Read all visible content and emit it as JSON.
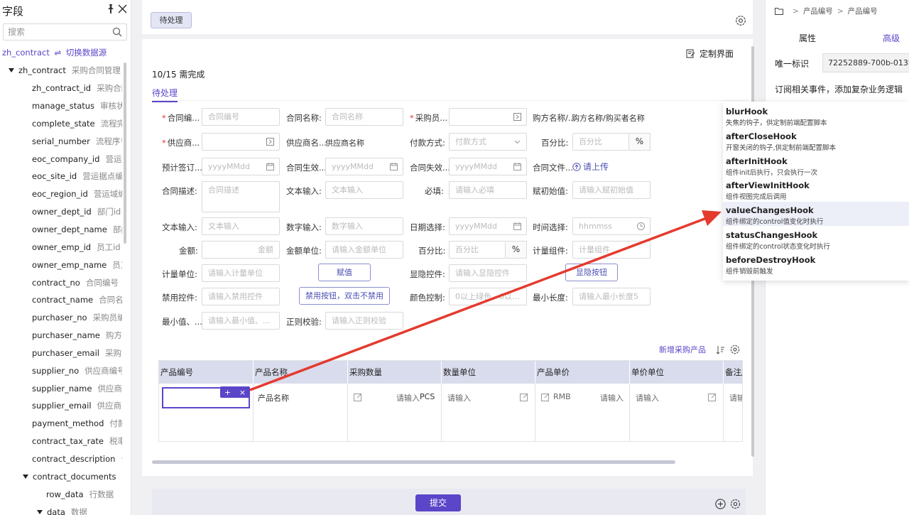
{
  "left_panel": {
    "title": "字段",
    "search_placeholder": "搜索",
    "source_name": "zh_contract",
    "source_switch_symbol": "⇌",
    "source_switch": "切换数据源",
    "tree": [
      {
        "name": "zh_contract",
        "desc": "采购合同管理",
        "level": 0,
        "expanded": true
      },
      {
        "name": "zh_contract_id",
        "desc": "采购合同",
        "level": 1
      },
      {
        "name": "manage_status",
        "desc": "审核状态",
        "level": 1
      },
      {
        "name": "complete_state",
        "desc": "流程完成",
        "level": 1
      },
      {
        "name": "serial_number",
        "desc": "流程序号",
        "level": 1
      },
      {
        "name": "eoc_company_id",
        "desc": "营运公",
        "level": 1
      },
      {
        "name": "eoc_site_id",
        "desc": "营运据点编号",
        "level": 1
      },
      {
        "name": "eoc_region_id",
        "desc": "营运域编号",
        "level": 1
      },
      {
        "name": "owner_dept_id",
        "desc": "部门id",
        "level": 1
      },
      {
        "name": "owner_dept_name",
        "desc": "部门",
        "level": 1
      },
      {
        "name": "owner_emp_id",
        "desc": "员工id",
        "level": 1
      },
      {
        "name": "owner_emp_name",
        "desc": "员工",
        "level": 1
      },
      {
        "name": "contract_no",
        "desc": "合同编号",
        "level": 1
      },
      {
        "name": "contract_name",
        "desc": "合同名称",
        "level": 1
      },
      {
        "name": "purchaser_no",
        "desc": "采购员编号",
        "level": 1
      },
      {
        "name": "purchaser_name",
        "desc": "购方名",
        "level": 1
      },
      {
        "name": "purchaser_email",
        "desc": "采购商",
        "level": 1
      },
      {
        "name": "supplier_no",
        "desc": "供应商编号",
        "level": 1
      },
      {
        "name": "supplier_name",
        "desc": "供应商名",
        "level": 1
      },
      {
        "name": "supplier_email",
        "desc": "供应商邮",
        "level": 1
      },
      {
        "name": "payment_method",
        "desc": "付款方",
        "level": 1
      },
      {
        "name": "contract_tax_rate",
        "desc": "税率",
        "level": 1
      },
      {
        "name": "contract_description",
        "desc": "合",
        "level": 1
      },
      {
        "name": "contract_documents",
        "desc": "合",
        "level": 1,
        "expanded": true
      },
      {
        "name": "row_data",
        "desc": "行数据",
        "level": 2
      },
      {
        "name": "data",
        "desc": "数据",
        "level": 2,
        "expanded": true
      }
    ]
  },
  "tabbar": {
    "pending_tab": "待处理"
  },
  "form": {
    "custom_link": "定制界面",
    "progress": "10/15 需完成",
    "section_tab": "待处理",
    "row1": {
      "f1_label": "合同编...",
      "f1_ph": "合同编号",
      "f2_label": "合同名称:",
      "f2_ph": "合同名称",
      "f3_label": "采购员...",
      "f4_label": "购方名称/...",
      "f4_value": "购方名称/购买者名称"
    },
    "row2": {
      "f1_label": "供应商...",
      "f2_label": "供应商名...",
      "f2_value": "供应商名称",
      "f3_label": "付款方式:",
      "f3_ph": "付款方式",
      "f4_label": "百分比:",
      "f4_ph": "百分比",
      "f4_unit": "%"
    },
    "row3": {
      "f1_label": "预计签订...",
      "f1_ph": "yyyyMMdd",
      "f2_label": "合同生效...",
      "f2_ph": "yyyyMMdd",
      "f3_label": "合同失效...",
      "f3_ph": "yyyyMMdd",
      "f4_label": "合同文件...",
      "f4_upload": "请上传"
    },
    "row4": {
      "f1_label": "合同描述:",
      "f1_ph": "合同描述",
      "f2_label": "文本输入:",
      "f2_ph": "文本输入",
      "f3_label": "必填:",
      "f3_ph": "请输入必填",
      "f4_label": "赋初始值:",
      "f4_ph": "请输入赋初始值"
    },
    "row5": {
      "f1_label": "文本输入:",
      "f1_ph": "文本输入",
      "f2_label": "数字输入:",
      "f2_ph": "数字输入",
      "f3_label": "日期选择:",
      "f3_ph": "yyyyMMdd",
      "f4_label": "时间选择:",
      "f4_ph": "hhmmss"
    },
    "row6": {
      "f1_label": "金额:",
      "f1_ph": "金额",
      "f2_label": "金额单位:",
      "f2_ph": "请输入金额单位",
      "f3_label": "百分比:",
      "f3_ph": "百分比",
      "f3_unit": "%",
      "f4_label": "计量组件:",
      "f4_ph": "计量组件"
    },
    "row7": {
      "f1_label": "计量单位:",
      "f1_ph": "请输入计量单位",
      "btn_assign": "赋值",
      "f3_label": "显隐控件:",
      "f3_ph": "请输入显隐控件",
      "btn_toggle": "显隐按钮"
    },
    "row8": {
      "f1_label": "禁用控件:",
      "f1_ph": "请输入禁用控件",
      "btn_disable": "禁用按钮，双击不禁用",
      "f3_label": "颜色控制:",
      "f3_ph": "0以上绿色，0以...",
      "f4_label": "最小长度:",
      "f4_ph": "请输入最小长度5"
    },
    "row9": {
      "f1_label": "最小值、...",
      "f1_ph": "请输入最小值、...",
      "f2_label": "正则校验:",
      "f2_ph": "请输入正则校验"
    }
  },
  "table": {
    "add_link": "新增采购产品",
    "headers": [
      "产品编号",
      "产品名称",
      "采购数量",
      "数量单位",
      "产品单价",
      "单价单位",
      "备注/"
    ],
    "row": {
      "name_cell": "产品名称",
      "qty_ph": "请输入",
      "qty_unit": "PCS",
      "unit_ph": "请输入",
      "price_prefix": "RMB",
      "price_ph": "请输入",
      "price_unit_ph": "请输入",
      "remark_ph": "请输"
    },
    "badge_add": "+",
    "badge_close": "×"
  },
  "footer": {
    "submit": "提交"
  },
  "right_panel": {
    "breadcrumb": [
      "产品编号",
      "产品编号"
    ],
    "breadcrumb_sep": ">",
    "tab_property": "属性",
    "tab_advanced": "高级",
    "uid_label": "唯一标识",
    "uid_value": "72252889-700b-013b...",
    "event_tip": "订阅相关事件，添加复杂业务逻辑"
  },
  "hooks": [
    {
      "name": "blurHook",
      "desc": "失焦的钩子，供定制前端配置脚本"
    },
    {
      "name": "afterCloseHook",
      "desc": "开窗关闭的钩子,供定制前端配置脚本"
    },
    {
      "name": "afterInitHook",
      "desc": "组件init后执行，只会执行一次"
    },
    {
      "name": "afterViewInitHook",
      "desc": "组件视图完成后调用"
    },
    {
      "name": "valueChangesHook",
      "desc": "组件绑定的control值变化时执行",
      "highlighted": true
    },
    {
      "name": "statusChangesHook",
      "desc": "组件绑定的control状态变化时执行"
    },
    {
      "name": "beforeDestroyHook",
      "desc": "组件销毁前触发"
    }
  ],
  "colors": {
    "accent": "#5b45c9",
    "arrow": "#e53a2e",
    "required": "#e4393c"
  }
}
